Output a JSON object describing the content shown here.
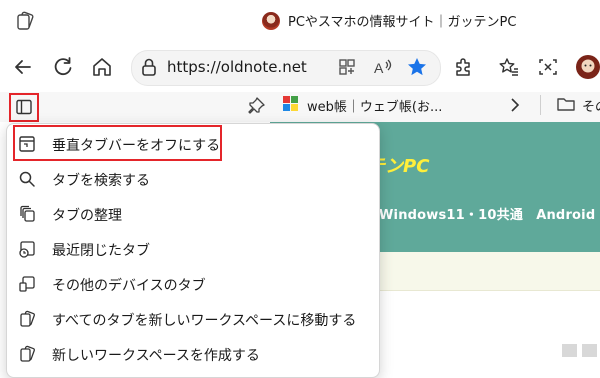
{
  "window": {
    "title": "PCやスマホの情報サイト｜ガッテンPC"
  },
  "toolbar": {
    "url": "https://oldnote.net"
  },
  "favorites": {
    "item1": "web帳｜ウェブ帳(お...",
    "item2": "その"
  },
  "page": {
    "logo_text": "テンPC",
    "nav_text": "Windows11・10共通　Android"
  },
  "menu": {
    "items": [
      {
        "label": "垂直タブバーをオフにする",
        "icon": "vertical-tabs-icon"
      },
      {
        "label": "タブを検索する",
        "icon": "search-icon"
      },
      {
        "label": "タブの整理",
        "icon": "organize-tabs-icon"
      },
      {
        "label": "最近閉じたタブ",
        "icon": "recently-closed-icon"
      },
      {
        "label": "その他のデバイスのタブ",
        "icon": "other-devices-icon"
      },
      {
        "label": "すべてのタブを新しいワークスペースに移動する",
        "icon": "workspaces-icon"
      },
      {
        "label": "新しいワークスペースを作成する",
        "icon": "workspaces-icon"
      }
    ]
  },
  "colors": {
    "highlight": "#e4252a",
    "site_banner": "#5fa99a",
    "logo": "#ffef3a",
    "star": "#1a73e8"
  }
}
